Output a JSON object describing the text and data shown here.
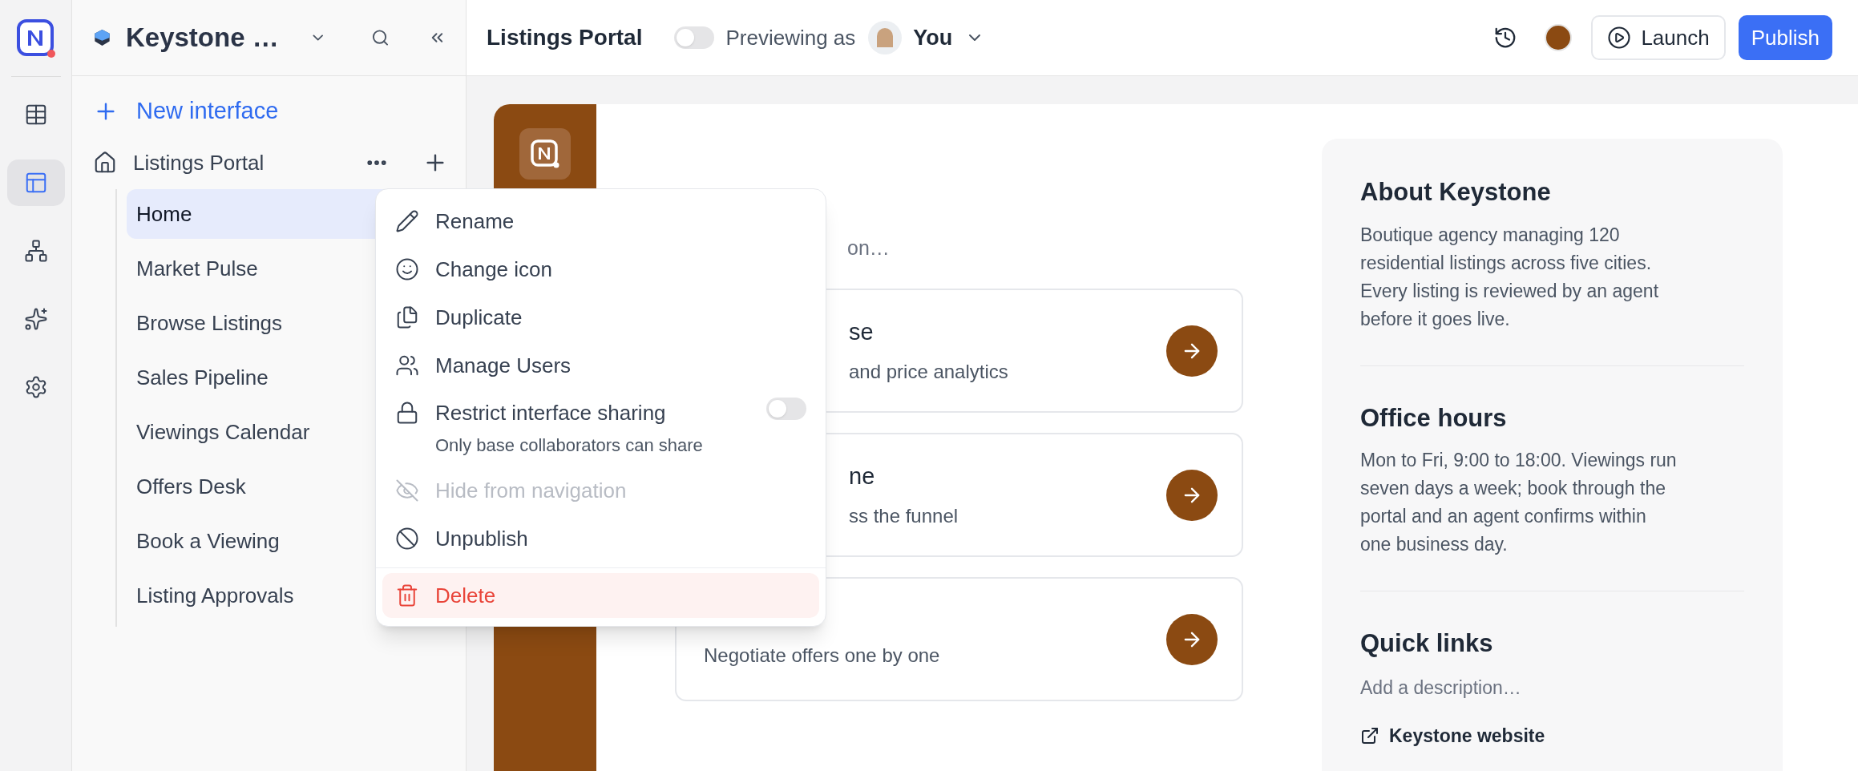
{
  "rail": {
    "items": [
      {
        "kind": "table",
        "selected": false
      },
      {
        "kind": "layout",
        "selected": true
      },
      {
        "kind": "hierarchy",
        "selected": false
      },
      {
        "kind": "sparkle",
        "selected": false
      },
      {
        "kind": "settings",
        "selected": false
      }
    ]
  },
  "sidebar": {
    "workspace": "Keystone …",
    "new_interface": "New interface",
    "interface": "Listings Portal",
    "pages": [
      {
        "label": "Home",
        "selected": true
      },
      {
        "label": "Market Pulse",
        "selected": false
      },
      {
        "label": "Browse Listings",
        "selected": false
      },
      {
        "label": "Sales Pipeline",
        "selected": false
      },
      {
        "label": "Viewings Calendar",
        "selected": false
      },
      {
        "label": "Offers Desk",
        "selected": false
      },
      {
        "label": "Book a Viewing",
        "selected": false
      },
      {
        "label": "Listing Approvals",
        "selected": false
      }
    ]
  },
  "topbar": {
    "title": "Listings Portal",
    "preview_toggle_on": false,
    "previewing_label": "Previewing as",
    "user": "You",
    "launch": "Launch",
    "publish": "Publish"
  },
  "menu": {
    "items": [
      {
        "kind": "item",
        "label": "Rename",
        "disabled": false
      },
      {
        "kind": "item",
        "label": "Change icon",
        "disabled": false
      },
      {
        "kind": "item",
        "label": "Duplicate",
        "disabled": false
      },
      {
        "kind": "item",
        "label": "Manage Users",
        "disabled": false
      },
      {
        "kind": "toggle",
        "label": "Restrict interface sharing",
        "description": "Only base collaborators can share",
        "on": false,
        "disabled": false
      },
      {
        "kind": "item",
        "label": "Hide from navigation",
        "disabled": true
      },
      {
        "kind": "item",
        "label": "Unpublish",
        "disabled": false
      },
      {
        "kind": "danger",
        "label": "Delete",
        "disabled": false
      }
    ]
  },
  "page": {
    "section_description": "on…",
    "cards": [
      {
        "kind": "partial",
        "title": "se",
        "description": "and price analytics"
      },
      {
        "kind": "partial",
        "title": "ne",
        "description": "ss the funnel"
      },
      {
        "kind": "full",
        "description": "Negotiate offers one by one"
      }
    ]
  },
  "info_panel": {
    "sections": [
      {
        "title": "About Keystone",
        "body": "Boutique agency managing 120 residential listings across five cities. Every listing is reviewed by an agent before it goes live."
      },
      {
        "title": "Office hours",
        "body": "Mon to Fri, 9:00 to 18:00. Viewings run seven days a week; book through the portal and an agent confirms within one business day."
      },
      {
        "title": "Quick links",
        "placeholder": "Add a description…",
        "link": "Keystone website"
      }
    ]
  }
}
